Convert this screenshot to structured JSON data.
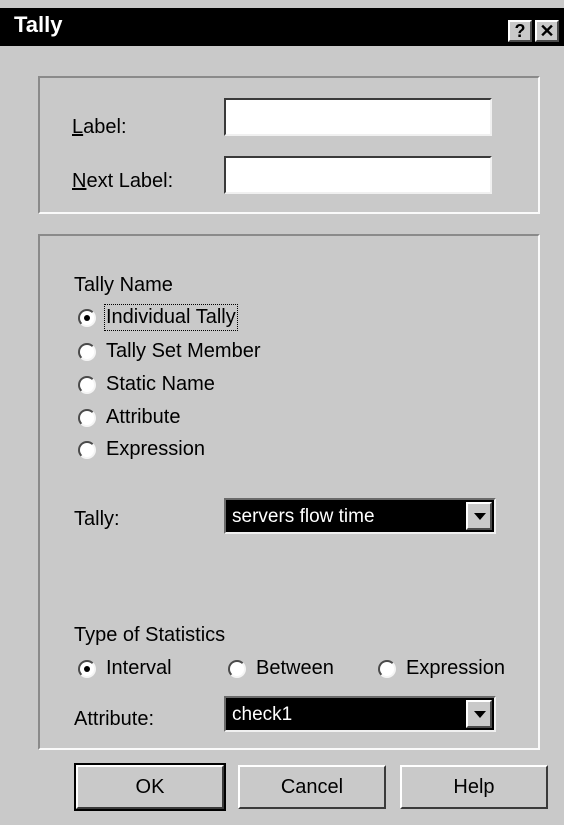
{
  "window": {
    "title": "Tally",
    "help_glyph": "?",
    "close_glyph": "✕"
  },
  "labels": {
    "label": "Label:",
    "next_label": "Next Label:"
  },
  "fields": {
    "label_value": "",
    "next_label_value": ""
  },
  "tally_name": {
    "heading": "Tally Name",
    "options": [
      {
        "text": "Individual Tally",
        "selected": true
      },
      {
        "text": "Tally Set Member",
        "selected": false
      },
      {
        "text": "Static Name",
        "selected": false
      },
      {
        "text": "Attribute",
        "selected": false
      },
      {
        "text": "Expression",
        "selected": false
      }
    ]
  },
  "tally": {
    "label": "Tally:",
    "value": "servers flow time"
  },
  "statistics": {
    "heading": "Type of Statistics",
    "options": [
      {
        "text": "Interval",
        "selected": true
      },
      {
        "text": "Between",
        "selected": false
      },
      {
        "text": "Expression",
        "selected": false
      }
    ]
  },
  "attribute": {
    "label": "Attribute:",
    "value": "check1"
  },
  "buttons": {
    "ok": "OK",
    "cancel": "Cancel",
    "help": "Help"
  }
}
